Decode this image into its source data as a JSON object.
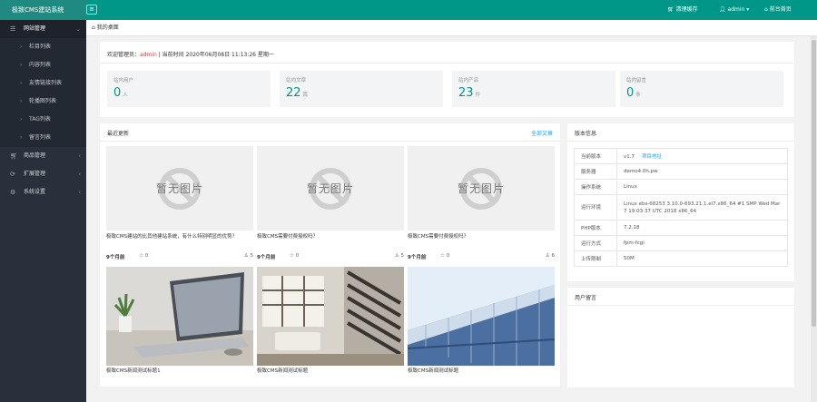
{
  "header": {
    "app_title": "极致CMS建站系统",
    "clear_cache": "清理缓存",
    "user": "admin",
    "front_home": "前台首页"
  },
  "sidebar": {
    "groups": [
      {
        "label": "网站管理",
        "icon": "list-icon",
        "open": true,
        "items": [
          "栏目列表",
          "内容列表",
          "友情链接列表",
          "轮播图列表",
          "TAG列表",
          "留言列表"
        ]
      },
      {
        "label": "商品管理",
        "icon": "cart-icon"
      },
      {
        "label": "扩展管理",
        "icon": "extension-icon"
      },
      {
        "label": "系统设置",
        "icon": "gear-icon"
      }
    ]
  },
  "tabbar": {
    "home_tab": "我的桌面"
  },
  "welcome": {
    "prefix": "欢迎管理员：",
    "admin": "admin",
    "time_text": "| 当前时间 2020年06月08日 11:13:26 星期一"
  },
  "stats": [
    {
      "label": "站内用户",
      "value": "0",
      "unit": "人"
    },
    {
      "label": "站内文章",
      "value": "22",
      "unit": "篇"
    },
    {
      "label": "站内产品",
      "value": "23",
      "unit": "件"
    },
    {
      "label": "站内留言",
      "value": "0",
      "unit": "条"
    }
  ],
  "latest": {
    "title": "最近更新",
    "all_link": "全部文章",
    "no_image_text": "暂无图片",
    "cards": [
      {
        "title": "极致CMS建站的比其他建站系统，有什么特别明显的优势？",
        "date": "9个月前",
        "likes": "0",
        "views": "5"
      },
      {
        "title": "极致CMS需要付费授权吗？",
        "date": "9个月前",
        "likes": "0",
        "views": "5"
      },
      {
        "title": "极致CMS需要付费授权吗？",
        "date": "9个月前",
        "likes": "0",
        "views": "6"
      },
      {
        "title": "极致CMS新闻测试标题1"
      },
      {
        "title": "极致CMS新闻测试标题"
      },
      {
        "title": "极致CMS新闻测试标题"
      }
    ]
  },
  "sysinfo": {
    "title": "版本信息",
    "rows": [
      {
        "key": "当前版本",
        "value": "v1.7",
        "link": "项目地址"
      },
      {
        "key": "服务器",
        "value": "demo4.0h.pw"
      },
      {
        "key": "操作系统",
        "value": "Linux"
      },
      {
        "key": "运行环境",
        "value": "Linux ebs-68253 3.10.0-693.21.1.el7.x86_64 #1 SMP Wed Mar 7 19:03:37 UTC 2018 x86_64"
      },
      {
        "key": "PHP版本",
        "value": "7.2.18"
      },
      {
        "key": "运行方式",
        "value": "fpm-fcgi"
      },
      {
        "key": "上传限制",
        "value": "50M"
      }
    ]
  },
  "messages": {
    "title": "用户留言"
  },
  "colors": {
    "header": "#009688",
    "sidebar": "#28303b",
    "accent_link": "#1e9fff",
    "stat_value": "#009688"
  }
}
